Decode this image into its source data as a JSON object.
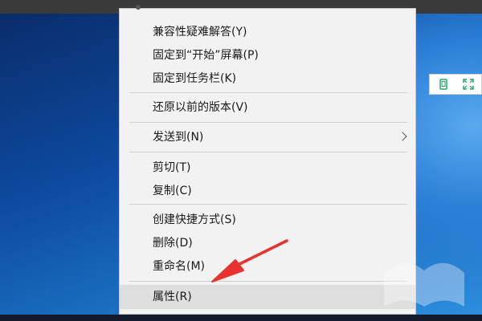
{
  "menu": {
    "partial_item": {
      "label": "..."
    },
    "items": [
      {
        "label": "兼容性疑难解答(Y)"
      },
      {
        "label": "固定到“开始”屏幕(P)"
      },
      {
        "label": "固定到任务栏(K)"
      },
      {
        "label": "还原以前的版本(V)"
      },
      {
        "label": "发送到(N)"
      },
      {
        "label": "剪切(T)"
      },
      {
        "label": "复制(C)"
      },
      {
        "label": "创建快捷方式(S)"
      },
      {
        "label": "删除(D)"
      },
      {
        "label": "重命名(M)"
      },
      {
        "label": "属性(R)"
      }
    ]
  },
  "widget": {
    "left_icon": "phone-icon",
    "right_icon": "expand-icon"
  },
  "arrow": {
    "icon": "red-arrow",
    "color": "#e8322e"
  },
  "colors": {
    "menu_bg": "#f2f2f2",
    "highlight": "#dedede",
    "desktop": "#1a6fc0"
  }
}
